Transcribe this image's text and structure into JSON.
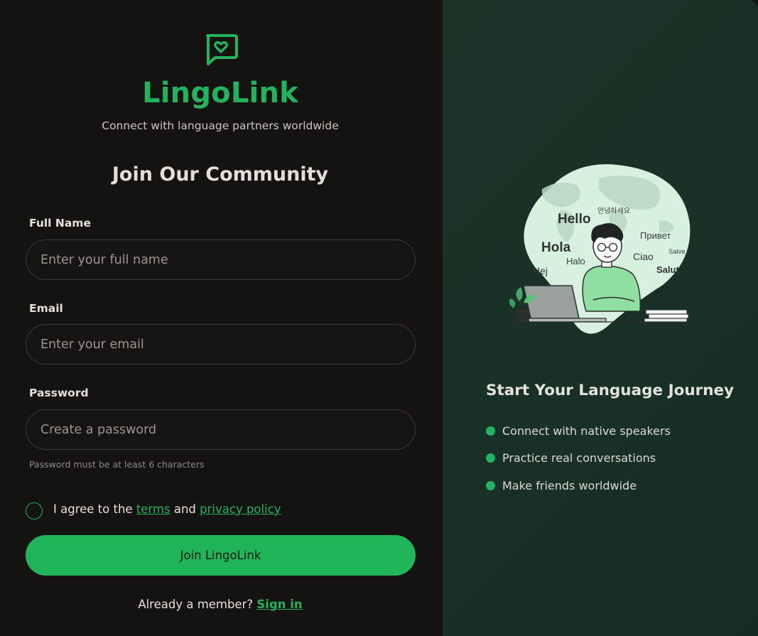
{
  "brand": {
    "name": "LingoLink",
    "tagline": "Connect with language partners worldwide",
    "logo_icon": "chat-heart-icon",
    "accent_color": "#22b35e"
  },
  "form": {
    "heading": "Join Our Community",
    "full_name": {
      "label": "Full Name",
      "placeholder": "Enter your full name",
      "value": ""
    },
    "email": {
      "label": "Email",
      "placeholder": "Enter your email",
      "value": ""
    },
    "password": {
      "label": "Password",
      "placeholder": "Create a password",
      "value": "",
      "hint": "Password must be at least 6 characters"
    },
    "agree": {
      "checked": false,
      "prefix": "I agree to the",
      "terms_link": "terms",
      "connector": "and",
      "privacy_link": "privacy policy"
    },
    "submit_label": "Join LingoLink",
    "signin_prompt": "Already a member?",
    "signin_link": "Sign in"
  },
  "promo": {
    "illustration_words": [
      "Hello",
      "안녕하세요",
      "Привет",
      "Hola",
      "Halo",
      "Ciao",
      "Salve",
      "Hej",
      "Salut"
    ],
    "title": "Start Your Language Journey",
    "features": [
      "Connect with native speakers",
      "Practice real conversations",
      "Make friends worldwide"
    ]
  }
}
